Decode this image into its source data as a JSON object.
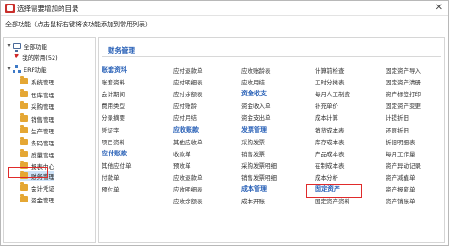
{
  "window": {
    "title": "选择需要增加的目录",
    "close_glyph": "✕"
  },
  "hint": "全部功能（点击鼠标右键将该功能添加到常用列表）",
  "tree": {
    "root": "全部功能",
    "favorites": "我的常用(52)",
    "erp": "ERP功能",
    "modules": [
      "系统管理",
      "仓库管理",
      "采购管理",
      "销售管理",
      "生产管理",
      "条码管理",
      "质量管理",
      "报表中心",
      "财务管理",
      "会计凭证",
      "资金管理"
    ],
    "selected": "财务管理"
  },
  "pane": {
    "section": "财务管理",
    "columns": [
      [
        {
          "kind": "cat",
          "text": "账套资料"
        },
        {
          "kind": "item",
          "text": "账套资料"
        },
        {
          "kind": "item",
          "text": "会计期间"
        },
        {
          "kind": "item",
          "text": "费用类型"
        },
        {
          "kind": "item",
          "text": "分录摘要"
        },
        {
          "kind": "item",
          "text": "凭证字"
        },
        {
          "kind": "item",
          "text": "项目资料"
        },
        {
          "kind": "cat",
          "text": "应付账款"
        },
        {
          "kind": "item",
          "text": "其他应付单"
        },
        {
          "kind": "item",
          "text": "付款单"
        },
        {
          "kind": "item",
          "text": "预付单"
        }
      ],
      [
        {
          "kind": "item",
          "text": "应付退款单"
        },
        {
          "kind": "item",
          "text": "应付明细表"
        },
        {
          "kind": "item",
          "text": "应付余额表"
        },
        {
          "kind": "item",
          "text": "应付账龄"
        },
        {
          "kind": "item",
          "text": "应付月结"
        },
        {
          "kind": "cat",
          "text": "应收账款"
        },
        {
          "kind": "item",
          "text": "其他应收单"
        },
        {
          "kind": "item",
          "text": "收款单"
        },
        {
          "kind": "item",
          "text": "预收单"
        },
        {
          "kind": "item",
          "text": "应收退款单"
        },
        {
          "kind": "item",
          "text": "应收明细表"
        },
        {
          "kind": "item",
          "text": "应收余额表"
        }
      ],
      [
        {
          "kind": "item",
          "text": "应收账龄表"
        },
        {
          "kind": "item",
          "text": "应收月结"
        },
        {
          "kind": "cat",
          "text": "资金收支"
        },
        {
          "kind": "item",
          "text": "资金收入单"
        },
        {
          "kind": "item",
          "text": "资金支出单"
        },
        {
          "kind": "cat",
          "text": "发票管理"
        },
        {
          "kind": "item",
          "text": "采购发票"
        },
        {
          "kind": "item",
          "text": "销售发票"
        },
        {
          "kind": "item",
          "text": "采购发票明细"
        },
        {
          "kind": "item",
          "text": "销售发票明细"
        },
        {
          "kind": "cat",
          "text": "成本管理"
        },
        {
          "kind": "item",
          "text": "成本开账"
        }
      ],
      [
        {
          "kind": "item",
          "text": "计算前检查"
        },
        {
          "kind": "item",
          "text": "工时分摊表"
        },
        {
          "kind": "item",
          "text": "每月人工制费"
        },
        {
          "kind": "item",
          "text": "补充单价"
        },
        {
          "kind": "item",
          "text": "成本计算"
        },
        {
          "kind": "item",
          "text": "销货成本表"
        },
        {
          "kind": "item",
          "text": "库存成本表"
        },
        {
          "kind": "item",
          "text": "产品成本表"
        },
        {
          "kind": "item",
          "text": "在制成本表"
        },
        {
          "kind": "item",
          "text": "成本分析"
        },
        {
          "kind": "cat",
          "text": "固定资产"
        },
        {
          "kind": "item",
          "text": "固定资产资料"
        }
      ],
      [
        {
          "kind": "item",
          "text": "固定资产导入"
        },
        {
          "kind": "item",
          "text": "固定资产清册"
        },
        {
          "kind": "item",
          "text": "资产标签打印"
        },
        {
          "kind": "item",
          "text": "固定资产变更"
        },
        {
          "kind": "item",
          "text": "计提折旧"
        },
        {
          "kind": "item",
          "text": "还原折旧"
        },
        {
          "kind": "item",
          "text": "折旧明细表"
        },
        {
          "kind": "item",
          "text": "每月工作量"
        },
        {
          "kind": "item",
          "text": "资产异动记录"
        },
        {
          "kind": "item",
          "text": "资产减值单"
        },
        {
          "kind": "item",
          "text": "资产报废单"
        },
        {
          "kind": "item",
          "text": "资产销账单"
        }
      ]
    ]
  }
}
